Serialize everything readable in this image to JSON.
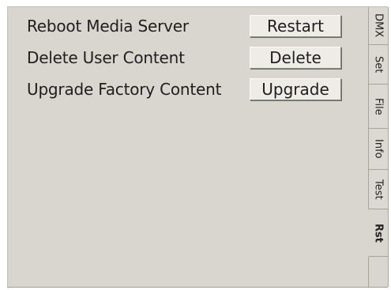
{
  "actions": [
    {
      "label": "Reboot Media Server",
      "button": "Restart"
    },
    {
      "label": "Delete User Content",
      "button": "Delete"
    },
    {
      "label": "Upgrade Factory Content",
      "button": "Upgrade"
    }
  ],
  "tabs": [
    {
      "label": "DMX",
      "active": false
    },
    {
      "label": "Set",
      "active": false
    },
    {
      "label": "File",
      "active": false
    },
    {
      "label": "Info",
      "active": false
    },
    {
      "label": "Test",
      "active": false
    },
    {
      "label": "Rst",
      "active": true
    }
  ],
  "colors": {
    "panel_background": "#d9d6cf",
    "button_face": "#eeece7",
    "text": "#1e1e1e"
  }
}
